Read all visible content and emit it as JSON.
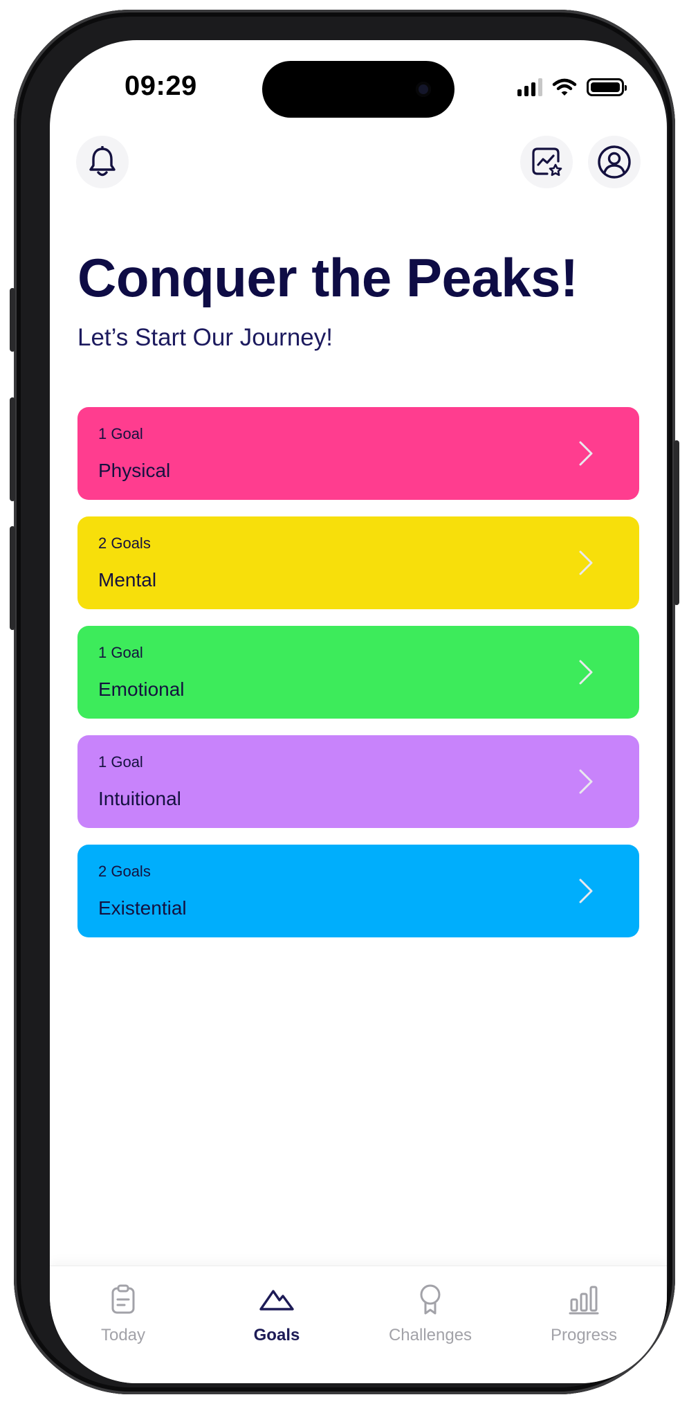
{
  "status_bar": {
    "time": "09:29"
  },
  "header": {
    "notifications_icon": "bell-icon",
    "stats_icon": "chart-star-icon",
    "profile_icon": "user-circle-icon"
  },
  "hero": {
    "title": "Conquer the Peaks!",
    "subtitle": "Let’s Start Our Journey!"
  },
  "goals": [
    {
      "count": "1 Goal",
      "name": "Physical",
      "color": "#ff3d8f"
    },
    {
      "count": "2 Goals",
      "name": "Mental",
      "color": "#f7df0b"
    },
    {
      "count": "1 Goal",
      "name": "Emotional",
      "color": "#3deb5b"
    },
    {
      "count": "1 Goal",
      "name": "Intuitional",
      "color": "#c883fb"
    },
    {
      "count": "2 Goals",
      "name": "Existential",
      "color": "#00aefc"
    }
  ],
  "tabs": [
    {
      "label": "Today",
      "icon": "clipboard-icon",
      "active": false
    },
    {
      "label": "Goals",
      "icon": "mountain-icon",
      "active": true
    },
    {
      "label": "Challenges",
      "icon": "award-icon",
      "active": false
    },
    {
      "label": "Progress",
      "icon": "bar-chart-icon",
      "active": false
    }
  ],
  "colors": {
    "title": "#0e0c45",
    "active_tab": "#1d1b56",
    "inactive_tab": "#a2a2a8"
  }
}
